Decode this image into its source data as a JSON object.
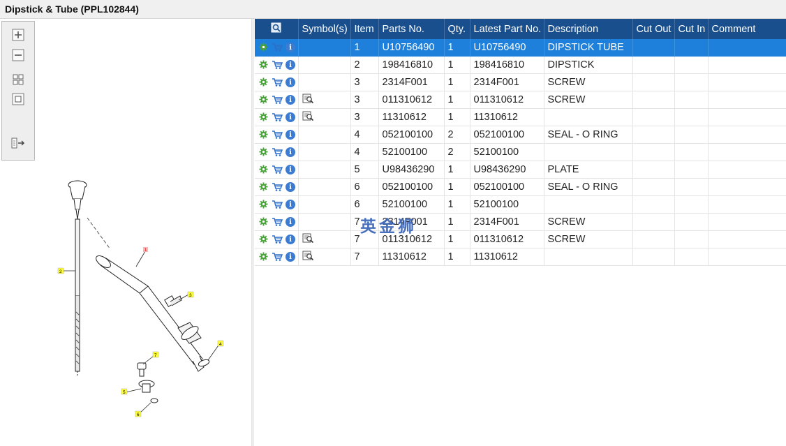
{
  "window": {
    "title": "Dipstick & Tube (PPL102844)"
  },
  "toolbar": {
    "buttons": [
      {
        "name": "zoom-in-button",
        "icon": "zoom-in-icon"
      },
      {
        "name": "zoom-out-button",
        "icon": "zoom-out-icon"
      },
      {
        "name": "fit-all-button",
        "icon": "fit-grid-icon"
      },
      {
        "name": "fit-page-button",
        "icon": "fit-page-icon"
      },
      {
        "name": "export-button",
        "icon": "export-arrow-icon"
      }
    ]
  },
  "drawing": {
    "callouts": [
      "1",
      "2",
      "3",
      "4",
      "5",
      "6",
      "7"
    ]
  },
  "grid": {
    "columns": [
      "",
      "Symbol(s)",
      "Item",
      "Parts No.",
      "Qty.",
      "Latest Part No.",
      "Description",
      "Cut Out",
      "Cut In",
      "Comment"
    ],
    "selected_row": 0,
    "rows": [
      {
        "symbol": false,
        "item": "1",
        "parts_no": "U10756490",
        "qty": "1",
        "latest": "U10756490",
        "description": "DIPSTICK TUBE",
        "cut_out": "",
        "cut_in": "",
        "comment": ""
      },
      {
        "symbol": false,
        "item": "2",
        "parts_no": "198416810",
        "qty": "1",
        "latest": "198416810",
        "description": "DIPSTICK",
        "cut_out": "",
        "cut_in": "",
        "comment": ""
      },
      {
        "symbol": false,
        "item": "3",
        "parts_no": "2314F001",
        "qty": "1",
        "latest": "2314F001",
        "description": "SCREW",
        "cut_out": "",
        "cut_in": "",
        "comment": ""
      },
      {
        "symbol": true,
        "item": "3",
        "parts_no": "011310612",
        "qty": "1",
        "latest": "011310612",
        "description": "SCREW",
        "cut_out": "",
        "cut_in": "",
        "comment": ""
      },
      {
        "symbol": true,
        "item": "3",
        "parts_no": "11310612",
        "qty": "1",
        "latest": "11310612",
        "description": "",
        "cut_out": "",
        "cut_in": "",
        "comment": ""
      },
      {
        "symbol": false,
        "item": "4",
        "parts_no": "052100100",
        "qty": "2",
        "latest": "052100100",
        "description": "SEAL - O RING",
        "cut_out": "",
        "cut_in": "",
        "comment": ""
      },
      {
        "symbol": false,
        "item": "4",
        "parts_no": "52100100",
        "qty": "2",
        "latest": "52100100",
        "description": "",
        "cut_out": "",
        "cut_in": "",
        "comment": ""
      },
      {
        "symbol": false,
        "item": "5",
        "parts_no": "U98436290",
        "qty": "1",
        "latest": "U98436290",
        "description": "PLATE",
        "cut_out": "",
        "cut_in": "",
        "comment": ""
      },
      {
        "symbol": false,
        "item": "6",
        "parts_no": "052100100",
        "qty": "1",
        "latest": "052100100",
        "description": "SEAL - O RING",
        "cut_out": "",
        "cut_in": "",
        "comment": ""
      },
      {
        "symbol": false,
        "item": "6",
        "parts_no": "52100100",
        "qty": "1",
        "latest": "52100100",
        "description": "",
        "cut_out": "",
        "cut_in": "",
        "comment": ""
      },
      {
        "symbol": false,
        "item": "7",
        "parts_no": "2314F001",
        "qty": "1",
        "latest": "2314F001",
        "description": "SCREW",
        "cut_out": "",
        "cut_in": "",
        "comment": ""
      },
      {
        "symbol": true,
        "item": "7",
        "parts_no": "011310612",
        "qty": "1",
        "latest": "011310612",
        "description": "SCREW",
        "cut_out": "",
        "cut_in": "",
        "comment": ""
      },
      {
        "symbol": true,
        "item": "7",
        "parts_no": "11310612",
        "qty": "1",
        "latest": "11310612",
        "description": "",
        "cut_out": "",
        "cut_in": "",
        "comment": ""
      }
    ]
  },
  "watermark": {
    "text": "英金狮"
  },
  "colors": {
    "header_bg": "#1a4f8e",
    "selected_row_bg": "#1e80da",
    "callout_fill": "#ffff33",
    "settings_icon": "#4aa33a",
    "cart_icon": "#2d6fc8",
    "info_icon": "#3b7bd1"
  }
}
